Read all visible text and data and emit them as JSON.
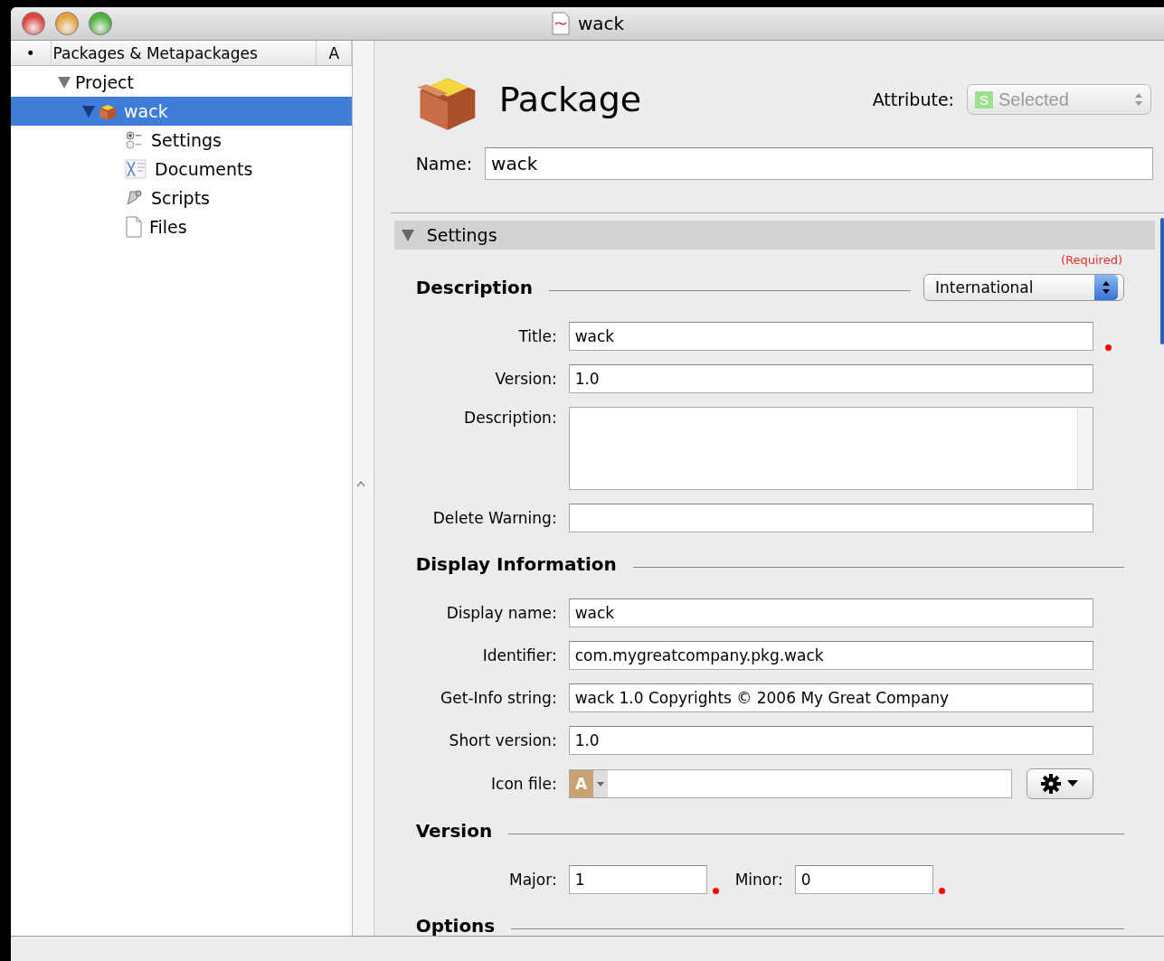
{
  "window": {
    "title": "wack"
  },
  "sidebar": {
    "columns": [
      "•",
      "Packages & Metapackages",
      "A"
    ],
    "tree": [
      {
        "label": "Project",
        "expanded": true,
        "selected": false,
        "children": [
          {
            "label": "wack",
            "kind": "package",
            "expanded": true,
            "selected": true,
            "children": [
              {
                "label": "Settings",
                "kind": "settings",
                "selected": false
              },
              {
                "label": "Documents",
                "kind": "documents",
                "selected": false
              },
              {
                "label": "Scripts",
                "kind": "scripts",
                "selected": false
              },
              {
                "label": "Files",
                "kind": "files",
                "selected": false
              }
            ]
          }
        ]
      }
    ]
  },
  "editor": {
    "title": "Package",
    "attribute": {
      "label": "Attribute:",
      "badge": "S",
      "value": "Selected",
      "disabled": true
    },
    "name": {
      "label": "Name:",
      "value": "wack"
    },
    "section": {
      "title": "Settings",
      "expanded": true,
      "note": "(Required)",
      "groups": [
        {
          "title": "Description",
          "popup": "International",
          "kind": "rows",
          "fields": [
            {
              "kind": "text",
              "label": "Title:",
              "value": "wack",
              "required": true
            },
            {
              "kind": "text",
              "label": "Version:",
              "value": "1.0",
              "required": false
            },
            {
              "kind": "textarea",
              "label": "Description:",
              "required": false
            },
            {
              "kind": "text",
              "label": "Delete Warning:",
              "required": false
            }
          ]
        },
        {
          "title": "Display Information",
          "kind": "rows",
          "fields": [
            {
              "kind": "text",
              "label": "Display name:",
              "value": "wack",
              "required": false
            },
            {
              "kind": "text",
              "label": "Identifier:",
              "value": "com.mygreatcompany.pkg.wack",
              "required": false
            },
            {
              "kind": "text",
              "label": "Get-Info string:",
              "value": "wack 1.0 Copyrights © 2006 My Great Company",
              "required": false
            },
            {
              "kind": "text",
              "label": "Short version:",
              "value": "1.0",
              "required": false
            },
            {
              "kind": "iconfile",
              "label": "Icon file:",
              "badge": "A",
              "required": false
            }
          ]
        },
        {
          "title": "Version",
          "kind": "inline",
          "fields": [
            {
              "kind": "text",
              "label": "Major:",
              "value": "1",
              "required": true
            },
            {
              "kind": "text",
              "label": "Minor:",
              "value": "0",
              "required": true
            }
          ]
        },
        {
          "title": "Options",
          "kind": "rows"
        }
      ]
    }
  }
}
